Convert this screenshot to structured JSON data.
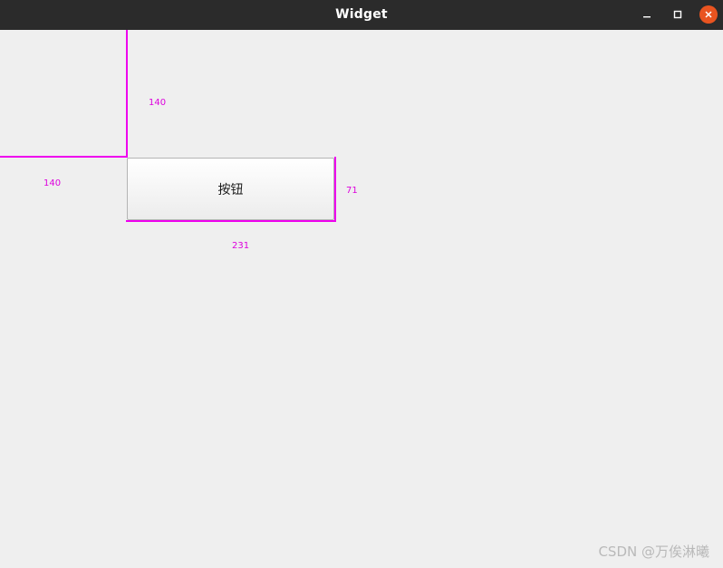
{
  "window": {
    "title": "Widget",
    "controls": {
      "minimize_icon": "minimize-icon",
      "maximize_icon": "maximize-icon",
      "close_icon": "close-icon",
      "close_color": "#e95420"
    }
  },
  "annotations": {
    "top_offset_label": "140",
    "left_offset_label": "140",
    "height_label": "71",
    "width_label": "231",
    "color": "#ee00ee"
  },
  "button": {
    "label": "按钮"
  },
  "watermark": "CSDN @万俟淋曦"
}
